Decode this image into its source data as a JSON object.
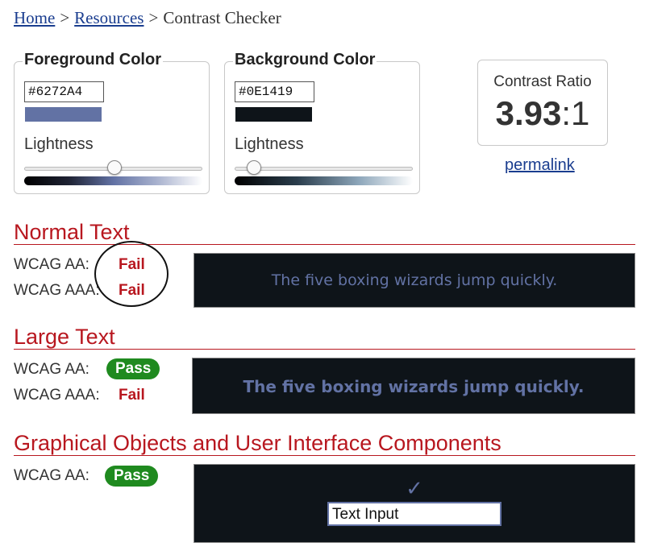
{
  "breadcrumb": {
    "home": "Home",
    "resources": "Resources",
    "current": "Contrast Checker",
    "separator": ">"
  },
  "foreground": {
    "legend": "Foreground Color",
    "hex": "#6272A4",
    "swatch_color": "#6272A4",
    "lightness_label": "Lightness",
    "lightness_fraction": 0.5
  },
  "background": {
    "legend": "Background Color",
    "hex": "#0E1419",
    "swatch_color": "#0E1419",
    "lightness_label": "Lightness",
    "lightness_fraction": 0.11
  },
  "ratio": {
    "title": "Contrast Ratio",
    "value": "3.93",
    "suffix": ":1",
    "permalink": "permalink"
  },
  "sections": {
    "normal": {
      "heading": "Normal Text",
      "aa_label": "WCAG AA:",
      "aa_result": "Fail",
      "aaa_label": "WCAG AAA:",
      "aaa_result": "Fail",
      "preview": "The five boxing wizards jump quickly."
    },
    "large": {
      "heading": "Large Text",
      "aa_label": "WCAG AA:",
      "aa_result": "Pass",
      "aaa_label": "WCAG AAA:",
      "aaa_result": "Fail",
      "preview": "The five boxing wizards jump quickly."
    },
    "graphical": {
      "heading": "Graphical Objects and User Interface Components",
      "aa_label": "WCAG AA:",
      "aa_result": "Pass",
      "check_glyph": "✓",
      "input_value": "Text Input"
    }
  },
  "colors": {
    "fail": "#B8171F",
    "pass_bg": "#1F8A1F",
    "link": "#1A3D8F",
    "preview_bg": "#0E1419",
    "preview_fg": "#6272A4"
  }
}
